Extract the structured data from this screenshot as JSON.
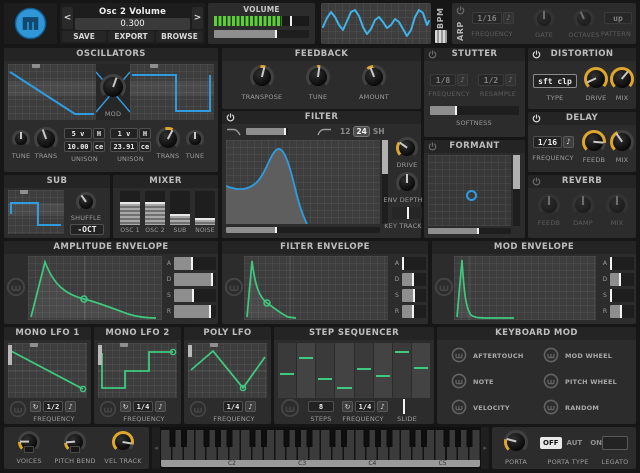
{
  "preset": {
    "title": "Osc 2 Volume",
    "value": "0.300",
    "prev": "<",
    "next": ">",
    "save": "SAVE",
    "export": "EXPORT",
    "browse": "BROWSE"
  },
  "volume": {
    "label": "VOLUME",
    "meter_level": "72%",
    "marker_pos": "80%",
    "slider_level": "66%"
  },
  "bpm": {
    "label": "BPM"
  },
  "arp": {
    "label": "ARP",
    "frequency_value": "1/16",
    "note_icon": "♪",
    "frequency_label": "FREQUENCY",
    "gate_label": "GATE",
    "octaves_label": "OCTAVES",
    "pattern_value": "up",
    "pattern_label": "PATTERN"
  },
  "oscillators": {
    "title": "OSCILLATORS",
    "mod_label": "MOD",
    "tune_label_1": "TUNE",
    "trans_label_1": "TRANS",
    "unison1": {
      "voices": "5 v",
      "mode": "H",
      "detune": "10.00",
      "unit": "ce",
      "label": "UNISON"
    },
    "unison2": {
      "voices": "1 v",
      "mode": "H",
      "detune": "23.91",
      "unit": "ce",
      "label": "UNISON"
    },
    "trans_label_2": "TRANS",
    "tune_label_2": "TUNE"
  },
  "feedback": {
    "title": "FEEDBACK",
    "knobs": [
      "TRANSPOSE",
      "TUNE",
      "AMOUNT"
    ]
  },
  "filter": {
    "title": "FILTER",
    "slopes": [
      "12",
      "24",
      "SH"
    ],
    "selected_slope": "24",
    "drive_label": "DRIVE",
    "env_depth_label": "ENV DEPTH",
    "key_track_label": "KEY TRACK"
  },
  "stutter": {
    "title": "STUTTER",
    "frequency_value": "1/8",
    "frequency_label": "FREQUENCY",
    "resample_value": "1/2",
    "resample_label": "RESAMPLE",
    "softness_label": "SOFTNESS",
    "note_icon": "♪"
  },
  "distortion": {
    "title": "DISTORTION",
    "type_value": "sft clp",
    "type_label": "TYPE",
    "drive_label": "DRIVE",
    "mix_label": "MIX"
  },
  "delay": {
    "title": "DELAY",
    "frequency_value": "1/16",
    "note_icon": "♪",
    "frequency_label": "FREQUENCY",
    "feedb_label": "FEEDB",
    "mix_label": "MIX"
  },
  "formant": {
    "title": "FORMANT"
  },
  "reverb": {
    "title": "REVERB",
    "feedb_label": "FEEDB",
    "damp_label": "DAMP",
    "mix_label": "MIX"
  },
  "sub": {
    "title": "SUB",
    "shuffle_label": "SHUFFLE",
    "octave_value": "-OCT"
  },
  "mixer": {
    "title": "MIXER",
    "channels": [
      {
        "label": "OSC 1",
        "level": "68%"
      },
      {
        "label": "OSC 2",
        "level": "68%"
      },
      {
        "label": "SUB",
        "level": "32%"
      },
      {
        "label": "NOISE",
        "level": "22%"
      }
    ]
  },
  "amp_env": {
    "title": "AMPLITUDE ENVELOPE",
    "sliders": [
      {
        "label": "A",
        "value": "45%"
      },
      {
        "label": "D",
        "value": "92%"
      },
      {
        "label": "S",
        "value": "48%"
      },
      {
        "label": "R",
        "value": "88%"
      }
    ]
  },
  "filter_env": {
    "title": "FILTER ENVELOPE",
    "sliders": [
      {
        "label": "A",
        "value": "5%"
      },
      {
        "label": "D",
        "value": "52%"
      },
      {
        "label": "S",
        "value": "56%"
      },
      {
        "label": "R",
        "value": "48%"
      }
    ]
  },
  "mod_env": {
    "title": "MOD ENVELOPE",
    "sliders": [
      {
        "label": "A",
        "value": "5%"
      },
      {
        "label": "D",
        "value": "45%"
      },
      {
        "label": "S",
        "value": "6%"
      },
      {
        "label": "R",
        "value": "48%"
      }
    ]
  },
  "lfo1": {
    "title": "MONO LFO 1",
    "sync_icon": "↻",
    "frequency_value": "1/2",
    "note_icon": "♪",
    "frequency_label": "FREQUENCY"
  },
  "lfo2": {
    "title": "MONO LFO 2",
    "sync_icon": "↻",
    "frequency_value": "1/4",
    "note_icon": "♪",
    "frequency_label": "FREQUENCY"
  },
  "poly_lfo": {
    "title": "POLY LFO",
    "frequency_value": "1/4",
    "note_icon": "♪",
    "frequency_label": "FREQUENCY"
  },
  "step_seq": {
    "title": "STEP SEQUENCER",
    "steps_value": "8",
    "steps_label": "STEPS",
    "sync_icon": "↻",
    "frequency_value": "1/4",
    "note_icon": "♪",
    "frequency_label": "FREQUENCY",
    "slide_label": "SLIDE",
    "step_levels": [
      "46%",
      "74%",
      "36%",
      "20%",
      "54%",
      "42%",
      "86%",
      "56%"
    ]
  },
  "keyboard_mod": {
    "title": "KEYBOARD MOD",
    "items": [
      "AFTERTOUCH",
      "NOTE",
      "VELOCITY",
      "MOD WHEEL",
      "PITCH WHEEL",
      "RANDOM"
    ]
  },
  "bottom": {
    "voices_label": "VOICES",
    "pitch_bend_label": "PITCH BEND",
    "vel_track_label": "VEL TRACK",
    "octaves": [
      "C2",
      "C3",
      "C4",
      "C5"
    ],
    "porta_label": "PORTA",
    "porta_type_label": "PORTA TYPE",
    "porta_options": [
      "OFF",
      "AUT",
      "ON"
    ],
    "porta_selected": "OFF",
    "legato_label": "LEGATO"
  },
  "colors": {
    "accent_blue": "#2f9ce0",
    "accent_green": "#3ec97e",
    "accent_yellow": "#dfa62d",
    "meter_green": "#63cc3a"
  }
}
